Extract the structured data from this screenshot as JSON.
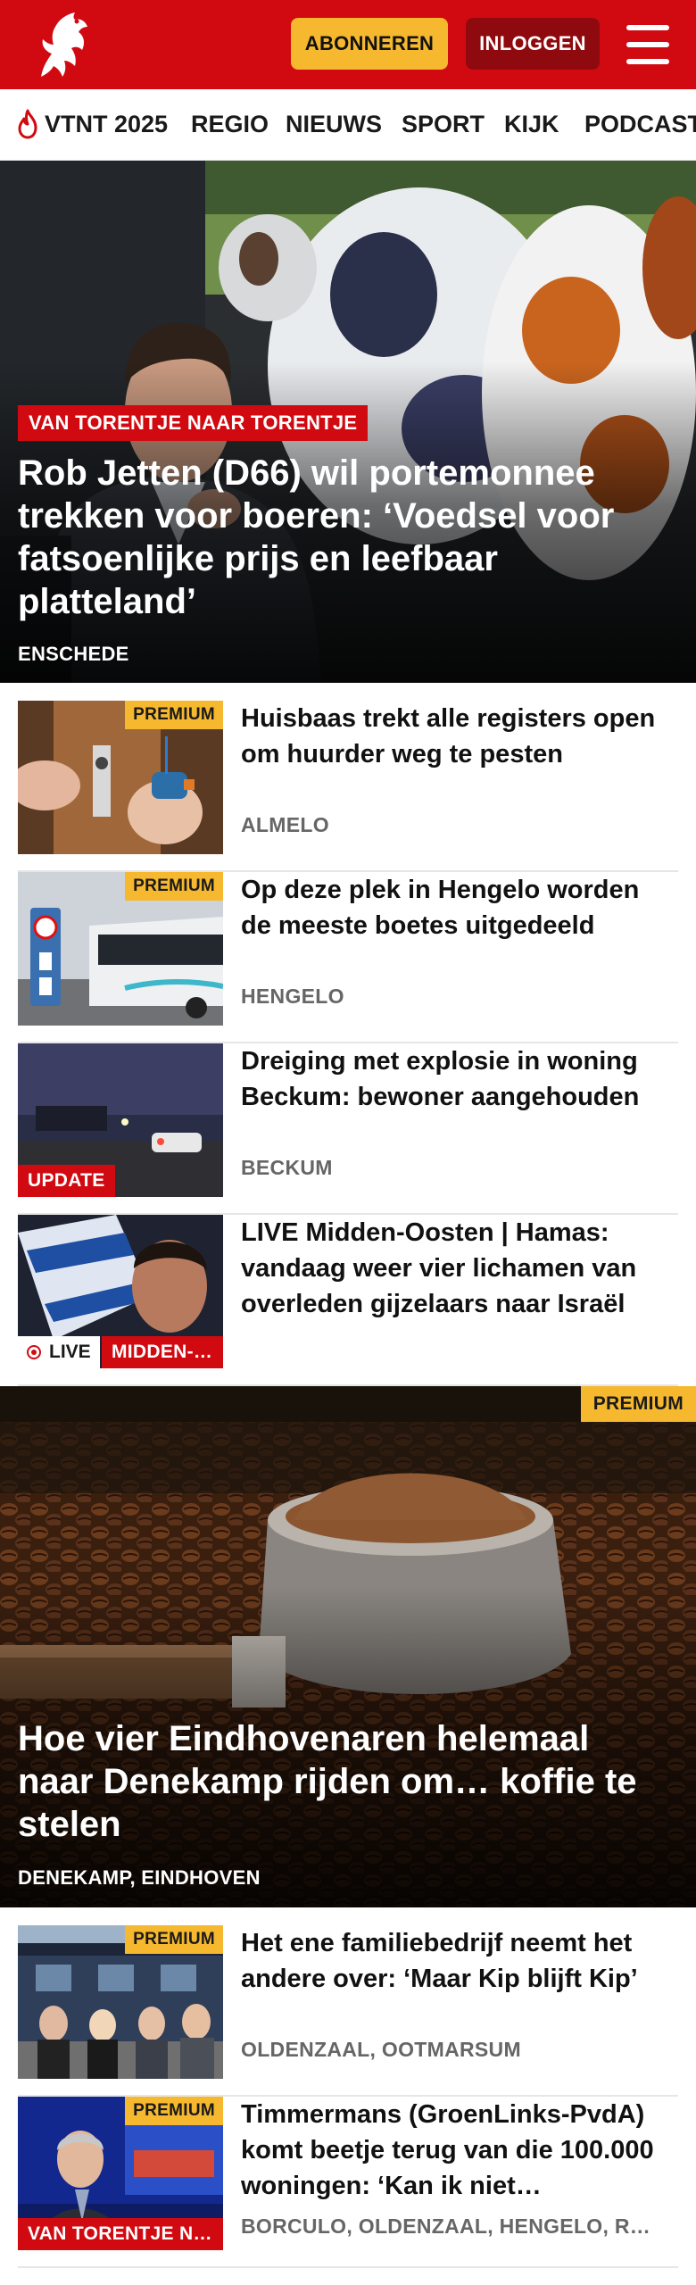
{
  "header": {
    "logo_name": "tubantia-horse-logo",
    "subscribe_label": "ABONNEREN",
    "login_label": "INLOGGEN",
    "menu_icon": "hamburger-menu-icon",
    "colors": {
      "brand": "#d10a11",
      "subscribe": "#f5b82e",
      "login": "#8f0a0e"
    }
  },
  "nav": {
    "items": [
      {
        "label": "VTNT 2025",
        "icon": "flame-icon"
      },
      {
        "label": "REGIO"
      },
      {
        "label": "NIEUWS"
      },
      {
        "label": "SPORT"
      },
      {
        "label": "KIJK"
      },
      {
        "label": "PODCAST"
      }
    ]
  },
  "hero1": {
    "kicker": "VAN TORENTJE NAAR TORENTJE",
    "title": "Rob Jetten (D66) wil portemonnee trekken voor boeren: ‘Voedsel voor fatsoenlijke prijs en leefbaar platteland’",
    "place": "ENSCHEDE"
  },
  "articles1": [
    {
      "badge": "PREMIUM",
      "title": "Huisbaas trekt alle registers open om huurder weg te pesten",
      "place": "ALMELO"
    },
    {
      "badge": "PREMIUM",
      "title": "Op deze plek in Hengelo worden de meeste boetes uitgedeeld",
      "place": "HENGELO"
    },
    {
      "tag": "UPDATE",
      "title": "Dreiging met explosie in woning Beckum: bewoner aangehouden",
      "place": "BECKUM"
    },
    {
      "live": "LIVE",
      "tag": "MIDDEN-…",
      "title": "LIVE Midden-Oosten | Hamas: vandaag weer vier lichamen van overleden gijzelaars naar Israël",
      "place": ""
    }
  ],
  "hero2": {
    "badge": "PREMIUM",
    "title": "Hoe vier Eindhovenaren helemaal naar Denekamp rijden om… koffie te stelen",
    "place": "DENEKAMP, EINDHOVEN"
  },
  "articles2": [
    {
      "badge": "PREMIUM",
      "title": "Het ene familiebedrijf neemt het andere over: ‘Maar Kip blijft Kip’",
      "place": "OLDENZAAL, OOTMARSUM"
    },
    {
      "badge": "PREMIUM",
      "tag": "VAN TORENTJE N…",
      "title": "Timmermans (GroenLinks-PvdA) komt beetje terug van die 100.000 woningen: ‘Kan ik niet…",
      "place": "BORCULO, OLDENZAAL, HENGELO, R…"
    }
  ]
}
